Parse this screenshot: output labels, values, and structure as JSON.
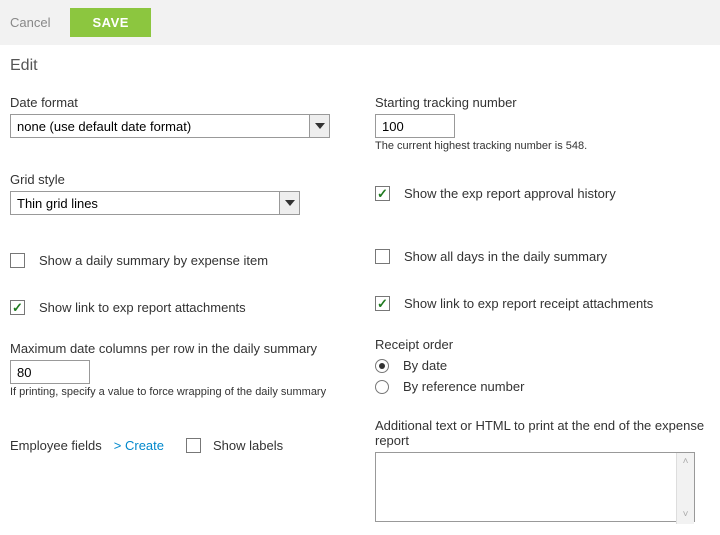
{
  "toolbar": {
    "cancel": "Cancel",
    "save": "SAVE"
  },
  "title": "Edit",
  "left": {
    "date_format": {
      "label": "Date format",
      "value": "none (use default date format)"
    },
    "grid_style": {
      "label": "Grid style",
      "value": "Thin grid lines"
    },
    "daily_summary_item": {
      "label": "Show a daily summary by expense item",
      "checked": false
    },
    "link_attachments": {
      "label": "Show link to exp report attachments",
      "checked": true
    },
    "max_cols": {
      "label": "Maximum date columns per row in the daily summary",
      "value": "80",
      "hint": "If printing, specify a value to force wrapping of the daily summary"
    },
    "employee_fields": {
      "label": "Employee fields",
      "create": "> Create",
      "show_labels": "Show labels",
      "show_labels_checked": false
    }
  },
  "right": {
    "tracking": {
      "label": "Starting tracking number",
      "value": "100",
      "hint": "The current highest tracking number is 548."
    },
    "approval_history": {
      "label": "Show the exp report approval history",
      "checked": true
    },
    "all_days": {
      "label": "Show all days in the daily summary",
      "checked": false
    },
    "link_receipt": {
      "label": "Show link to exp report receipt attachments",
      "checked": true
    },
    "receipt_order": {
      "label": "Receipt order",
      "by_date": "By date",
      "by_ref": "By reference number",
      "selected": "date"
    },
    "footer_html": {
      "label": "Additional text or HTML to print at the end of the expense report",
      "value": ""
    }
  }
}
